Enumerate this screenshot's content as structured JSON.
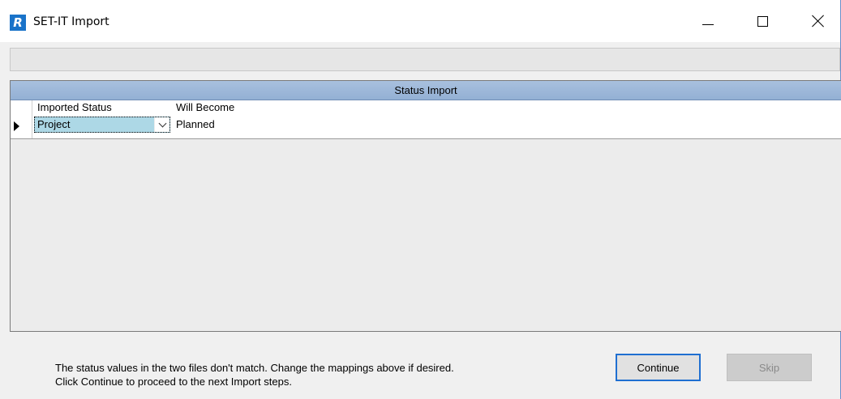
{
  "window": {
    "title": "SET-IT Import",
    "app_icon_letter": "R"
  },
  "grid": {
    "band_title": "Status Import",
    "columns": [
      "Imported Status",
      "Will Become"
    ],
    "rows": [
      {
        "imported_status": "Project",
        "will_become": "Planned",
        "current": true
      }
    ]
  },
  "footer": {
    "message_line1": "The status values in the two files don't match. Change the mappings above if desired.",
    "message_line2": "Click Continue to proceed to the next Import steps.",
    "continue_label": "Continue",
    "skip_label": "Skip"
  },
  "colors": {
    "accent": "#1f6fd1",
    "band": "#a8c0de",
    "selected_cell": "#add8e6"
  }
}
